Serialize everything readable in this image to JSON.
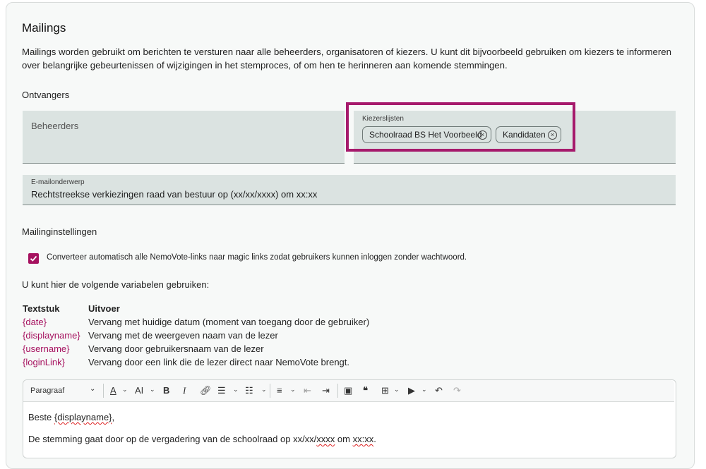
{
  "section": {
    "title": "Mailings",
    "description": "Mailings worden gebruikt om berichten te versturen naar alle beheerders, organisatoren of kiezers. U kunt dit bijvoorbeeld gebruiken om kiezers te informeren over belangrijke gebeurtenissen of wijzigingen in het stemproces, of om hen te herinneren aan komende stemmingen."
  },
  "recipients": {
    "heading": "Ontvangers",
    "admins_placeholder": "Beheerders",
    "voterlists_label": "Kiezerslijsten",
    "chips": [
      "Schoolraad BS Het Voorbeeld",
      "Kandidaten"
    ]
  },
  "subject": {
    "label": "E-mailonderwerp",
    "value": "Rechtstreekse verkiezingen raad van bestuur op (xx/xx/xxxx) om xx:xx"
  },
  "settings": {
    "heading": "Mailinginstellingen",
    "magic_links_label": "Converteer automatisch alle NemoVote-links naar magic links zodat gebruikers kunnen inloggen zonder wachtwoord.",
    "magic_links_checked": true
  },
  "variables": {
    "intro": "U kunt hier de volgende variabelen gebruiken:",
    "col_text": "Textstuk",
    "col_output": "Uitvoer",
    "rows": [
      {
        "var": "{date}",
        "desc": "Vervang met huidige datum (moment van toegang door de gebruiker)"
      },
      {
        "var": "{displayname}",
        "desc": "Vervang met de weergeven naam van de lezer"
      },
      {
        "var": "{username}",
        "desc": "Vervang door gebruikersnaam van de lezer"
      },
      {
        "var": "{loginLink}",
        "desc": "Vervang door een link die de lezer direct naar NemoVote brengt."
      }
    ]
  },
  "editor": {
    "paragraph_select": "Paragraaf",
    "line1_prefix": "Beste ",
    "line1_var": "{displayname}",
    "line1_suffix": ",",
    "line2_prefix": "De stemming gaat door op de vergadering van de schoolraad op xx/xx/",
    "line2_mid1": "xxxx",
    "line2_mid2": " om ",
    "line2_mid3": "xx:xx",
    "line2_end": "."
  },
  "colors": {
    "accent": "#a6125f",
    "highlight": "#a61a6c",
    "field_bg": "#dbe3e1"
  }
}
